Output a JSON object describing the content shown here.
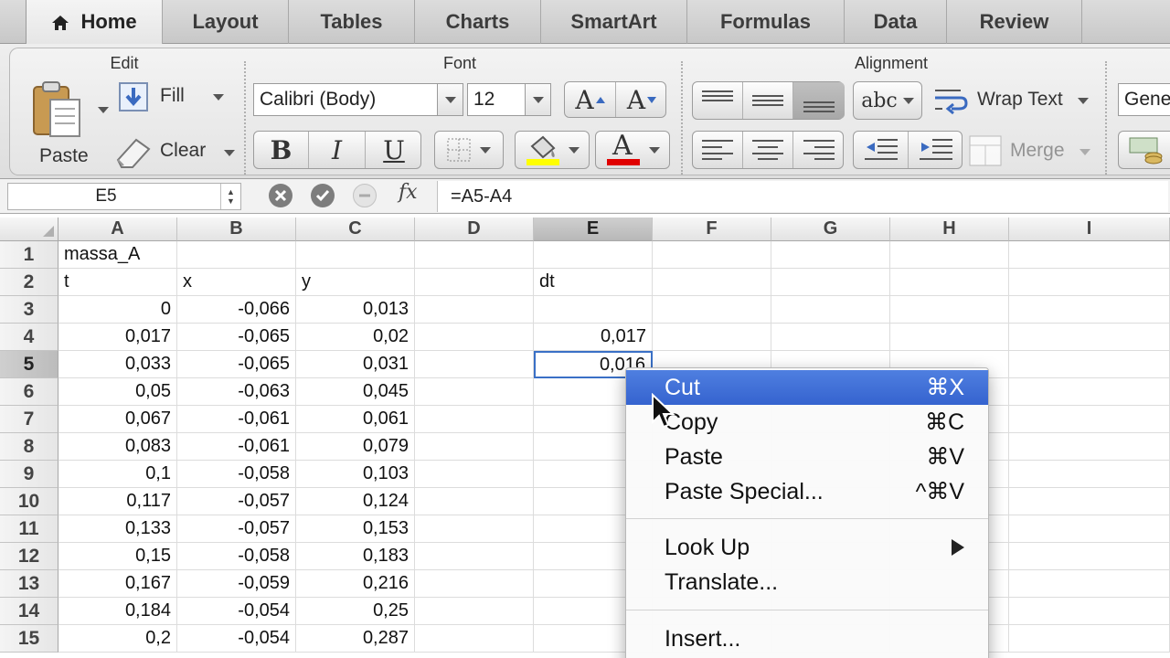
{
  "tabs": [
    {
      "label": "Home",
      "active": true
    },
    {
      "label": "Layout"
    },
    {
      "label": "Tables"
    },
    {
      "label": "Charts"
    },
    {
      "label": "SmartArt"
    },
    {
      "label": "Formulas"
    },
    {
      "label": "Data"
    },
    {
      "label": "Review"
    }
  ],
  "ribbon": {
    "groups": {
      "edit": "Edit",
      "font": "Font",
      "alignment": "Alignment"
    },
    "paste_label": "Paste",
    "fill_label": "Fill",
    "clear_label": "Clear",
    "font_name": "Calibri (Body)",
    "font_size": "12",
    "bold": "B",
    "italic": "I",
    "underline": "U",
    "grow_font": "A",
    "shrink_font": "A",
    "font_color_glyph": "A",
    "orientation_label": "abc",
    "wrap_text_label": "Wrap Text",
    "merge_label": "Merge",
    "number_format": "Gene",
    "fill_color": "#ffff00",
    "font_color": "#e00000"
  },
  "formula_bar": {
    "cell_ref": "E5",
    "fx": "fx",
    "formula": "=A5-A4"
  },
  "sheet": {
    "columns": [
      "A",
      "B",
      "C",
      "D",
      "E",
      "F",
      "G",
      "H",
      "I"
    ],
    "selected_column": "E",
    "rows": [
      "1",
      "2",
      "3",
      "4",
      "5",
      "6",
      "7",
      "8",
      "9",
      "10",
      "11",
      "12",
      "13",
      "14",
      "15"
    ],
    "selected_row": "5",
    "cells": {
      "A1": "massa_A",
      "A2": "t",
      "B2": "x",
      "C2": "y",
      "E2": "dt",
      "A3": "0",
      "B3": "-0,066",
      "C3": "0,013",
      "A4": "0,017",
      "B4": "-0,065",
      "C4": "0,02",
      "E4": "0,017",
      "A5": "0,033",
      "B5": "-0,065",
      "C5": "0,031",
      "E5": "0,016",
      "A6": "0,05",
      "B6": "-0,063",
      "C6": "0,045",
      "A7": "0,067",
      "B7": "-0,061",
      "C7": "0,061",
      "A8": "0,083",
      "B8": "-0,061",
      "C8": "0,079",
      "A9": "0,1",
      "B9": "-0,058",
      "C9": "0,103",
      "A10": "0,117",
      "B10": "-0,057",
      "C10": "0,124",
      "A11": "0,133",
      "B11": "-0,057",
      "C11": "0,153",
      "A12": "0,15",
      "B12": "-0,058",
      "C12": "0,183",
      "A13": "0,167",
      "B13": "-0,059",
      "C13": "0,216",
      "A14": "0,184",
      "B14": "-0,054",
      "C14": "0,25",
      "A15": "0,2",
      "B15": "-0,054",
      "C15": "0,287"
    }
  },
  "context_menu": {
    "items": [
      {
        "label": "Cut",
        "shortcut": "⌘X",
        "highlighted": true
      },
      {
        "label": "Copy",
        "shortcut": "⌘C"
      },
      {
        "label": "Paste",
        "shortcut": "⌘V"
      },
      {
        "label": "Paste Special...",
        "shortcut": "^⌘V"
      },
      {
        "label": "Look Up",
        "submenu": true
      },
      {
        "label": "Translate..."
      },
      {
        "label": "Insert..."
      }
    ]
  },
  "colors": {
    "menu_highlight": "#3f6fd8",
    "active_cell_border": "#3a70c6"
  }
}
